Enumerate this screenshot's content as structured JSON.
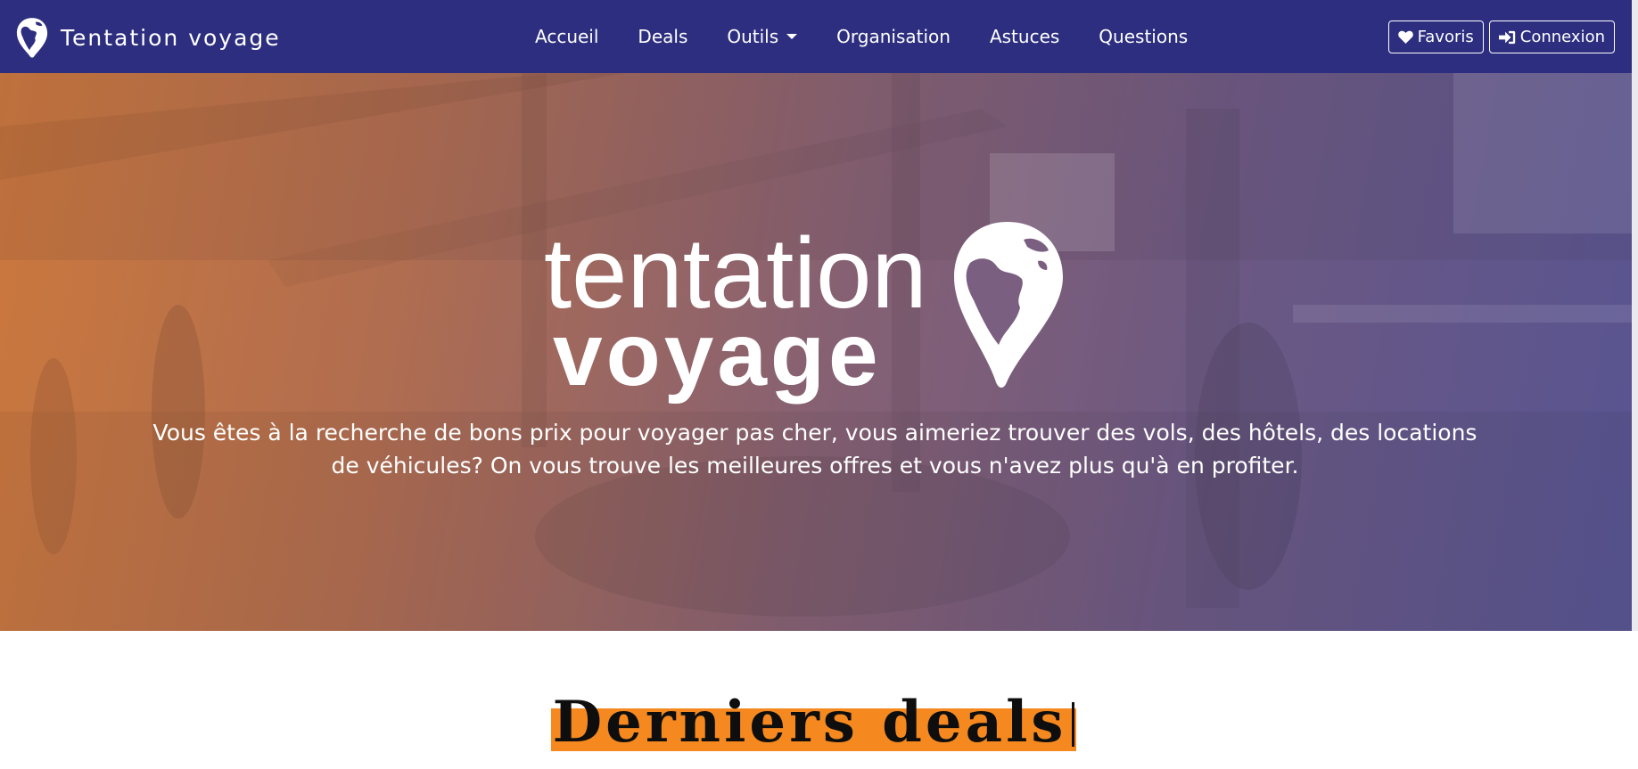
{
  "brand": {
    "name": "Tentation voyage"
  },
  "nav": {
    "links": [
      "Accueil",
      "Deals",
      "Outils",
      "Organisation",
      "Astuces",
      "Questions"
    ],
    "favorites_label": "Favoris",
    "login_label": "Connexion"
  },
  "hero": {
    "logo_word1": "tentation",
    "logo_word2": "voyage",
    "tagline_line1": "Vous êtes à la recherche de bons prix pour voyager pas cher, vous aimeriez trouver des vols, des hôtels, des locations",
    "tagline_line2": "de véhicules? On vous trouve les meilleures offres et vous n'avez plus qu'à en profiter."
  },
  "deals": {
    "heading": "Derniers deals"
  },
  "colors": {
    "navbar": "#2d2e7f",
    "accent": "#f5891f",
    "hero_orange": "#d07a3e",
    "hero_purple": "#5a5694"
  }
}
